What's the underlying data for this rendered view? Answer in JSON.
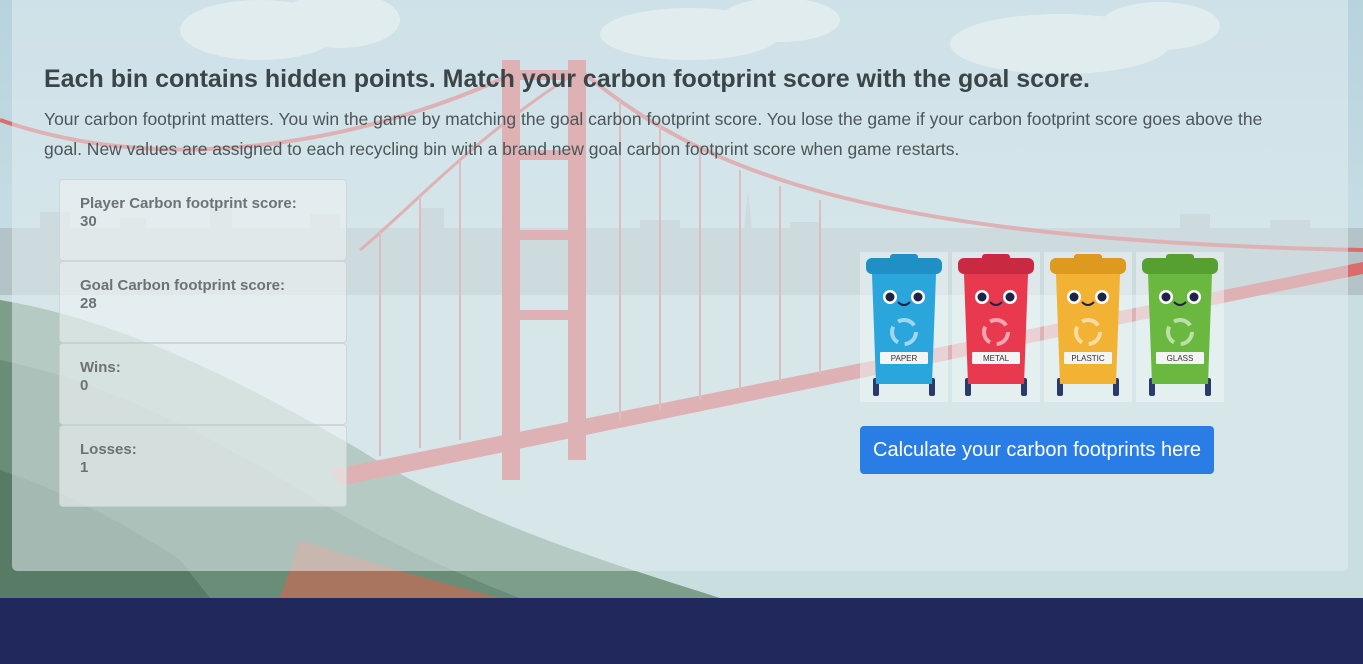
{
  "game": {
    "headline": "Each bin contains hidden points. Match your carbon footprint score with the goal score.",
    "intro": "Your carbon footprint matters. You win the game by matching the goal carbon footprint score. You lose the game if your carbon footprint score goes above the goal. New values are assigned to each recycling bin with a brand new goal carbon footprint score when game restarts."
  },
  "stats": {
    "player_label": "Player Carbon footprint score:",
    "player_value": "30",
    "goal_label": "Goal Carbon footprint score:",
    "goal_value": "28",
    "wins_label": "Wins:",
    "wins_value": "0",
    "losses_label": "Losses:",
    "losses_value": "1"
  },
  "bins": [
    {
      "label": "PAPER",
      "color": "#2aa6dd",
      "lid": "#1f8fc6",
      "icon": "recycle-icon"
    },
    {
      "label": "METAL",
      "color": "#e8394f",
      "lid": "#c92a42",
      "icon": "recycle-icon"
    },
    {
      "label": "PLASTIC",
      "color": "#f2b233",
      "lid": "#dd9a1f",
      "icon": "recycle-icon"
    },
    {
      "label": "GLASS",
      "color": "#6ab840",
      "lid": "#569f31",
      "icon": "recycle-icon"
    }
  ],
  "actions": {
    "calculate_label": "Calculate your carbon footprints here"
  },
  "colors": {
    "accent": "#2b7de6",
    "footer": "#21295c",
    "bridge": "#d96c6c"
  }
}
